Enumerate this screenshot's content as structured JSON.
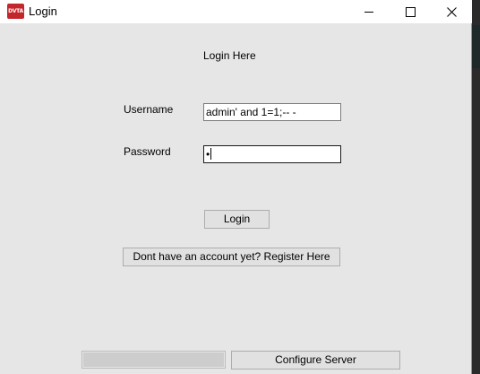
{
  "window": {
    "title": "Login",
    "app_icon_text": "DVTA"
  },
  "form": {
    "heading": "Login Here",
    "username_label": "Username",
    "username_value": "admin' and 1=1;-- -",
    "password_label": "Password",
    "password_value": "•",
    "login_label": "Login",
    "register_label": "Dont have an account yet? Register Here",
    "configure_label": "Configure Server",
    "progress_value": 0
  },
  "icons": {
    "app": "dvta-app-icon",
    "minimize": "minimize-icon",
    "maximize": "maximize-icon",
    "close": "close-icon"
  }
}
